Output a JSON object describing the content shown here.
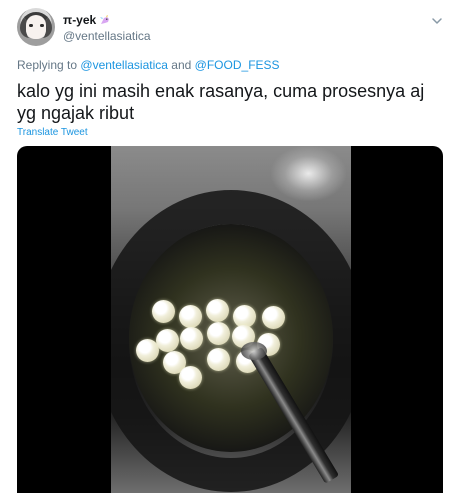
{
  "author": {
    "display_name": "π-yek",
    "emoji": "unicorn-icon",
    "handle": "@ventellasiatica"
  },
  "reply": {
    "prefix": "Replying to",
    "mention1": "@ventellasiatica",
    "conjunction": "and",
    "mention2": "@FOOD_FESS"
  },
  "tweet": {
    "text": "kalo yg ini masih enak rasanya, cuma prosesnya aj yg ngajak ribut",
    "translate": "Translate Tweet"
  },
  "media": {
    "type": "video-frame",
    "subject": "round dough balls frying in oil"
  },
  "icons": {
    "more": "chevron-down-icon"
  },
  "colors": {
    "text": "#14171a",
    "secondary": "#657786",
    "link": "#1b95e0",
    "media_background": "#000000"
  }
}
